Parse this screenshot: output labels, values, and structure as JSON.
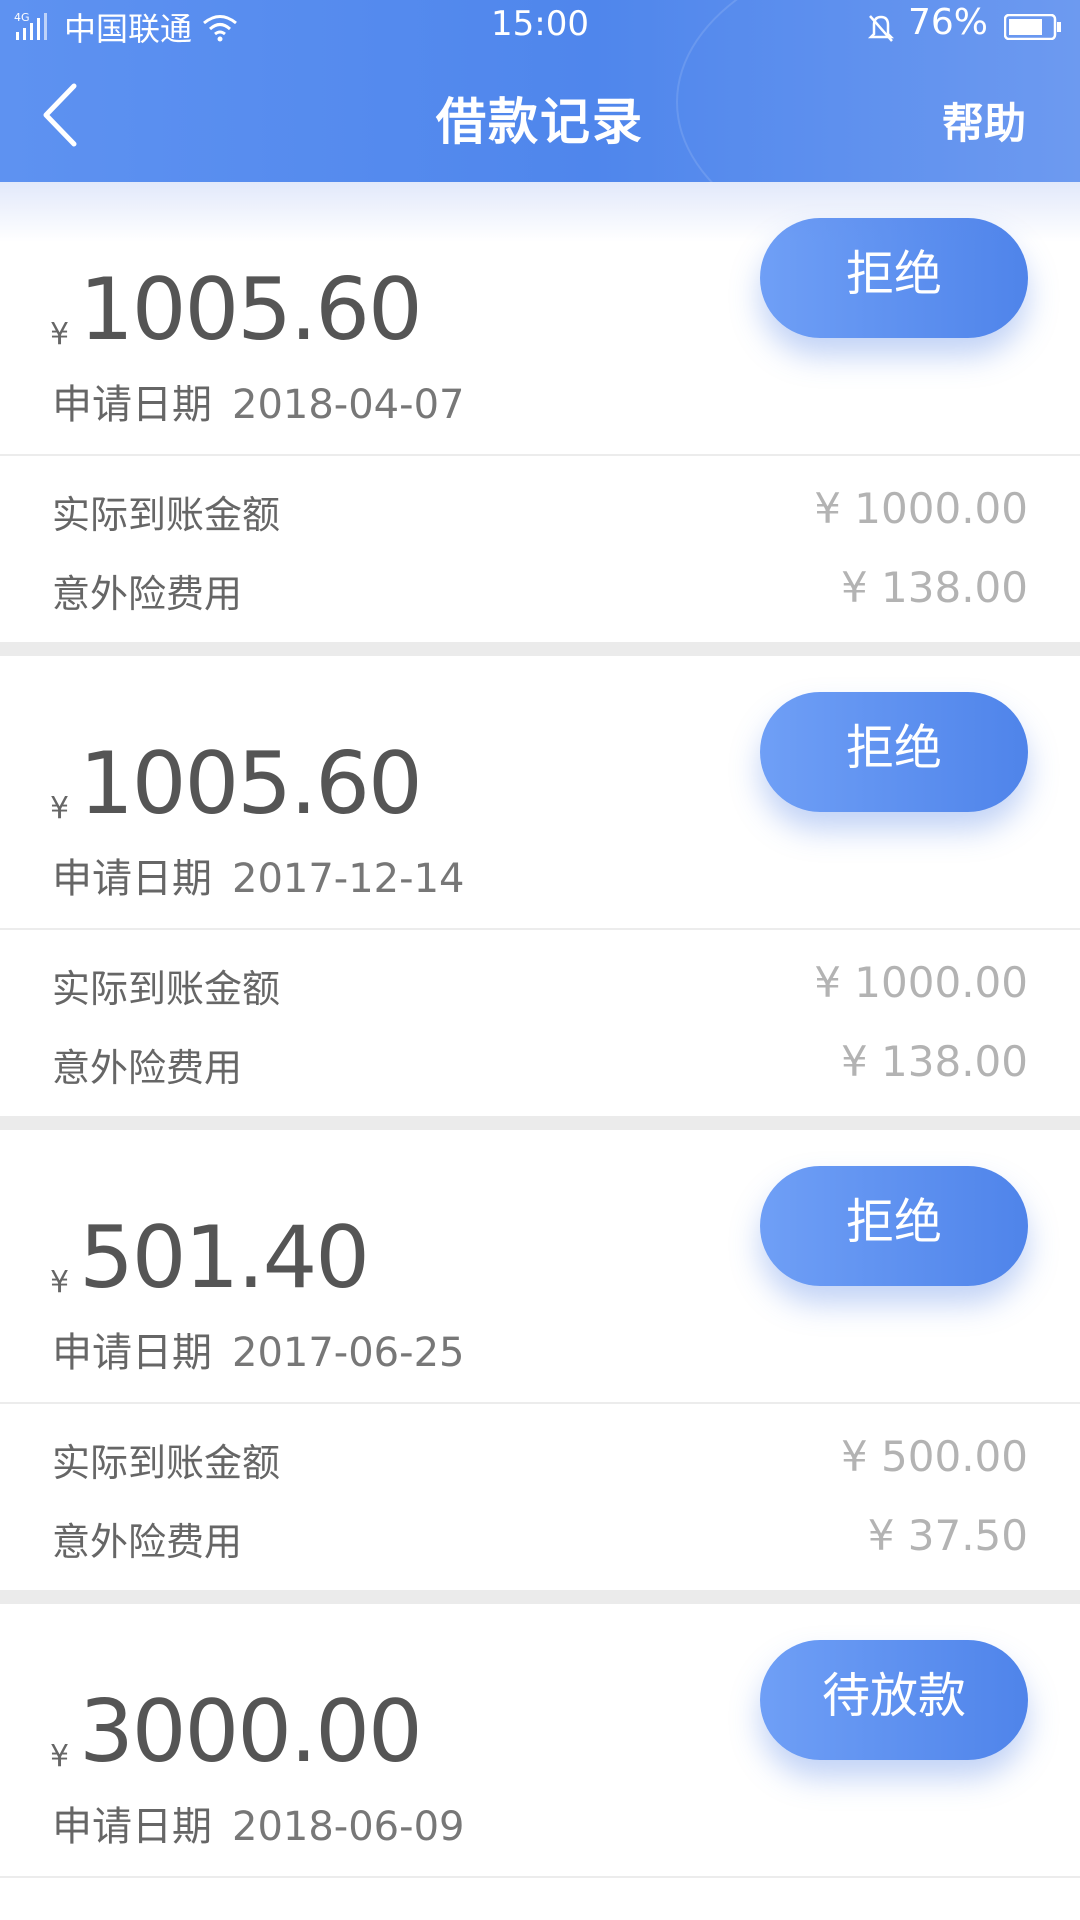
{
  "status_bar": {
    "network": "4G",
    "carrier": "中国联通",
    "time": "15:00",
    "battery": "76%"
  },
  "nav": {
    "title": "借款记录",
    "help": "帮助"
  },
  "colors": {
    "header_start": "#5e92f1",
    "header_end": "#6d9af0",
    "button_start": "#6f9ff6",
    "button_end": "#4f84ea"
  },
  "records": [
    {
      "currency": "¥",
      "amount": "1005.60",
      "date_label": "申请日期",
      "date": "2018-04-07",
      "status": "拒绝",
      "actual_label": "实际到账金额",
      "actual_value": "¥ 1000.00",
      "insurance_label": "意外险费用",
      "insurance_value": "¥ 138.00"
    },
    {
      "currency": "¥",
      "amount": "1005.60",
      "date_label": "申请日期",
      "date": "2017-12-14",
      "status": "拒绝",
      "actual_label": "实际到账金额",
      "actual_value": "¥ 1000.00",
      "insurance_label": "意外险费用",
      "insurance_value": "¥ 138.00"
    },
    {
      "currency": "¥",
      "amount": "501.40",
      "date_label": "申请日期",
      "date": "2017-06-25",
      "status": "拒绝",
      "actual_label": "实际到账金额",
      "actual_value": "¥ 500.00",
      "insurance_label": "意外险费用",
      "insurance_value": "¥ 37.50"
    },
    {
      "currency": "¥",
      "amount": "3000.00",
      "date_label": "申请日期",
      "date": "2018-06-09",
      "status": "待放款"
    }
  ]
}
